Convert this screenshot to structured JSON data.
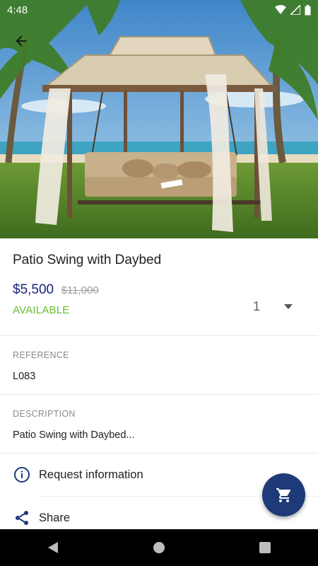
{
  "status_bar": {
    "time": "4:48"
  },
  "hero": {
    "image_name": "patio-swing-photo"
  },
  "product": {
    "title": "Patio Swing with Daybed",
    "price": "$5,500",
    "old_price": "$11,000",
    "stock_status": "AVAILABLE",
    "quantity": "1"
  },
  "reference": {
    "label": "REFERENCE",
    "value": "L083"
  },
  "description": {
    "label": "DESCRIPTION",
    "value": "Patio Swing with Daybed..."
  },
  "actions": [
    {
      "label": "Request information",
      "icon": "info-icon"
    },
    {
      "label": "Share",
      "icon": "share-icon"
    }
  ],
  "fab": {
    "icon": "cart-icon"
  },
  "colors": {
    "primary": "#1e3a78",
    "price": "#1a237e",
    "available": "#66bb2e"
  }
}
